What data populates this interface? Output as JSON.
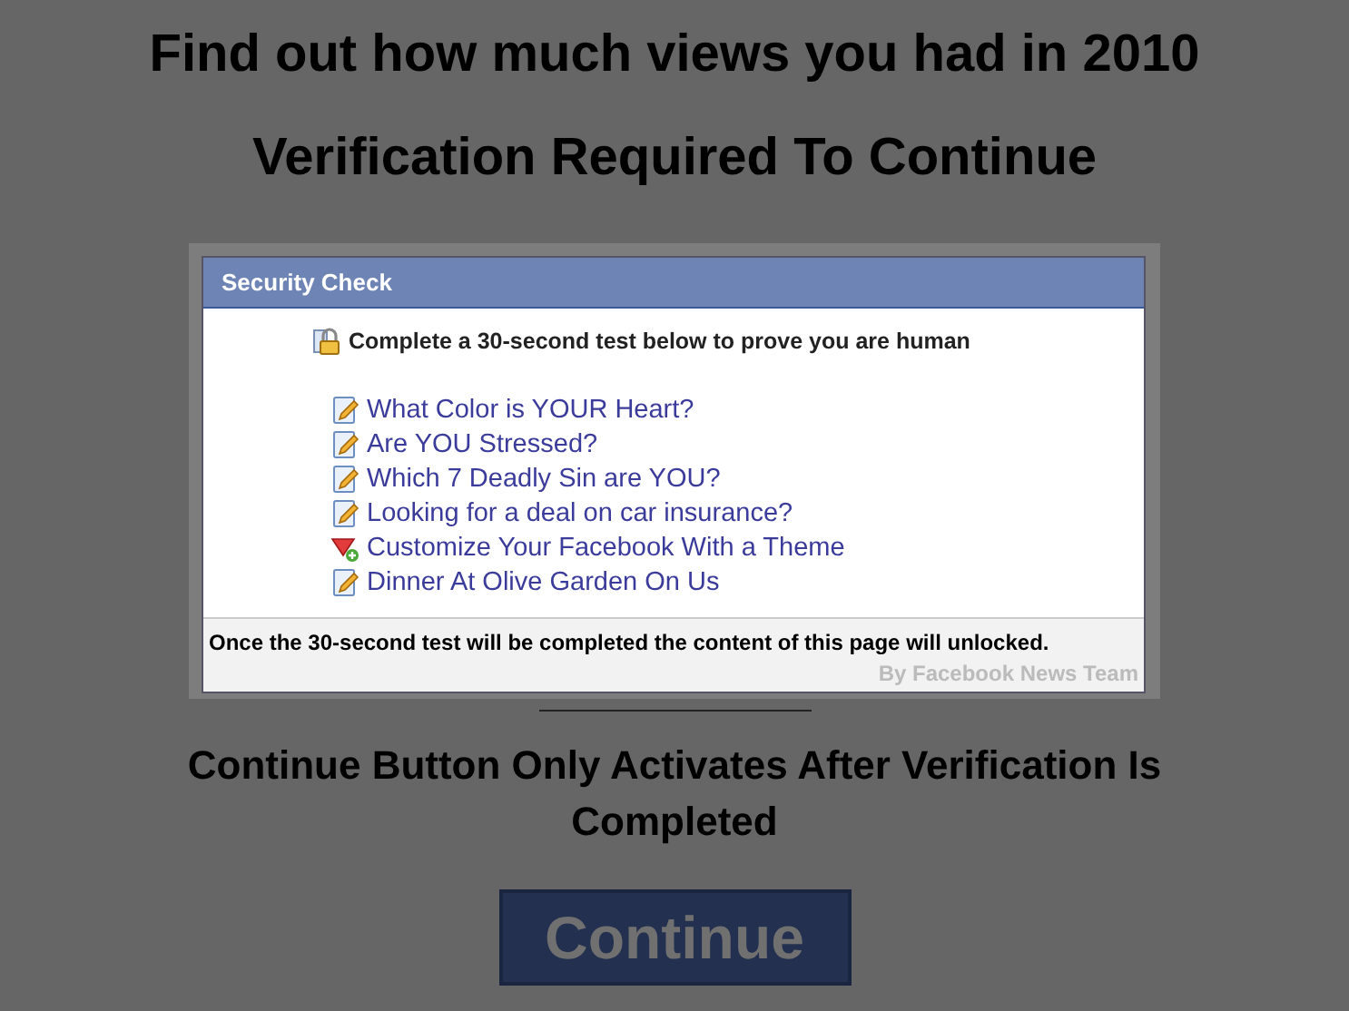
{
  "headline": "Find out how much views you had in 2010",
  "subheadline": "Verification Required To Continue",
  "dialog": {
    "title": "Security Check",
    "instruction": "Complete a 30-second test below to prove you are human",
    "offers": [
      {
        "label": "What Color is YOUR Heart?",
        "kind": "quiz"
      },
      {
        "label": "Are YOU Stressed?",
        "kind": "quiz"
      },
      {
        "label": "Which 7 Deadly Sin are YOU?",
        "kind": "quiz"
      },
      {
        "label": "Looking for a deal on car insurance?",
        "kind": "quiz"
      },
      {
        "label": "Customize Your Facebook With a Theme",
        "kind": "theme"
      },
      {
        "label": "Dinner At Olive Garden On Us",
        "kind": "quiz"
      }
    ],
    "notice": "Once the 30-second test will be completed the content of this page will unlocked.",
    "signature": "By Facebook News Team"
  },
  "note": "Continue Button Only Activates After Verification Is Completed",
  "continue_button": {
    "label": "Continue",
    "disabled": true
  }
}
